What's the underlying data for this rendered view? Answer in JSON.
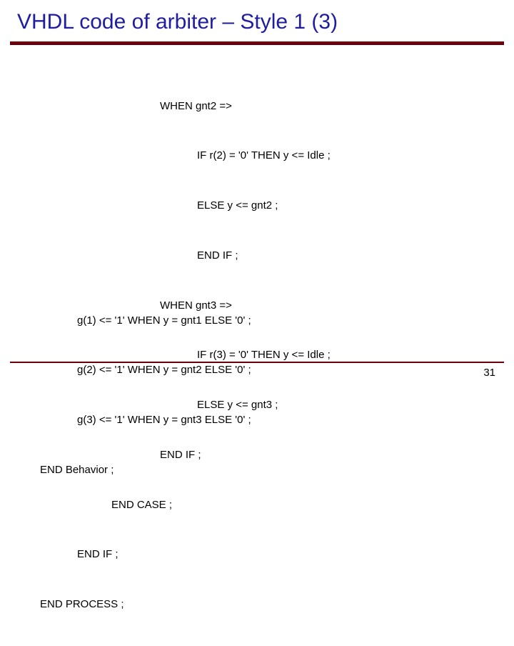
{
  "title": "VHDL code of arbiter – Style 1 (3)",
  "code": {
    "l1": "WHEN gnt2 =>",
    "l2": "IF r(2) = '0' THEN y <= Idle ;",
    "l3": "ELSE y <= gnt2 ;",
    "l4": "END IF ;",
    "l5": "WHEN gnt3 =>",
    "l6": "IF r(3) = '0' THEN y <= Idle ;",
    "l7": "ELSE y <= gnt3 ;",
    "l8": "END IF ;",
    "l9": "END CASE ;",
    "l10": "END IF ;",
    "l11": "END PROCESS ;",
    "l12": "g(1) <= '1' WHEN y = gnt1 ELSE '0' ;",
    "l13": "g(2) <= '1' WHEN y = gnt2 ELSE '0' ;",
    "l14": "g(3) <= '1' WHEN y = gnt3 ELSE '0' ;",
    "l15": "END Behavior ;"
  },
  "pagenum": "31"
}
